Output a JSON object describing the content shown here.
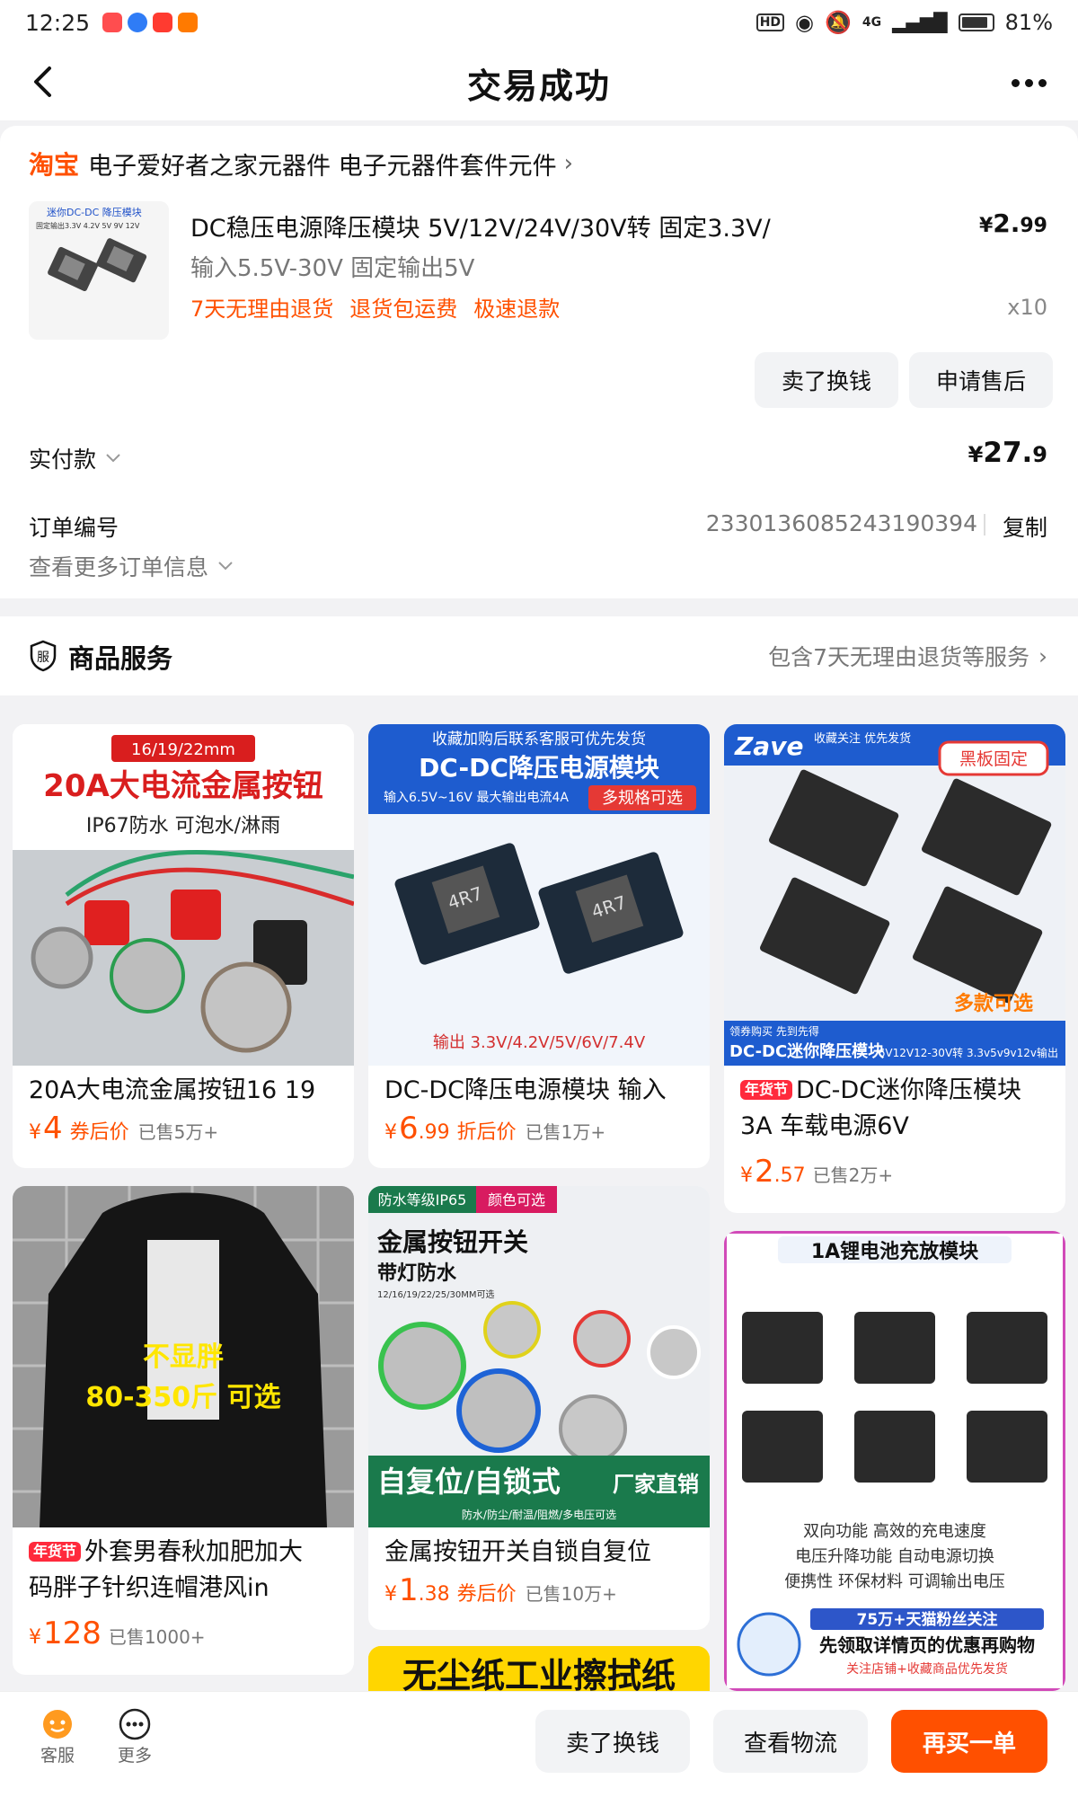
{
  "status_bar": {
    "time": "12:25",
    "hd": "HD",
    "network": "4G",
    "battery": "81%"
  },
  "nav": {
    "title": "交易成功"
  },
  "order": {
    "shop_tag": "淘宝",
    "shop_name": "电子爱好者之家元器件 电子元器件套件元件",
    "product_title": "DC稳压电源降压模块 5V/12V/24V/30V转 固定3.3V/",
    "product_spec": "输入5.5V-30V 固定输出5V",
    "product_tags": [
      "7天无理由退货",
      "退货包运费",
      "极速退款"
    ],
    "price_currency": "¥",
    "price_int": "2.",
    "price_dec": "99",
    "quantity": "x10",
    "thumb_text": "迷你DC-DC 降压模块",
    "thumb_sub": "固定输出3.3V 4.2V 5V 9V 12V",
    "btn_sell": "卖了换钱",
    "btn_aftersale": "申请售后",
    "paid_label": "实付款",
    "paid_currency": "¥",
    "paid_int": "27.",
    "paid_dec": "9",
    "order_no_label": "订单编号",
    "order_no": "2330136085243190394",
    "copy_label": "复制",
    "more_info": "查看更多订单信息"
  },
  "service": {
    "icon_glyph": "服",
    "title": "商品服务",
    "desc": "包含7天无理由退货等服务"
  },
  "feed": [
    {
      "img_top_tag": "16/19/22mm",
      "img_headline": "20A大电流金属按钮",
      "img_sub": "IP67防水 可泡水/淋雨",
      "title": "20A大电流金属按钮16 19",
      "price_int": "4",
      "price_dec": "",
      "price_tag": "券后价",
      "sold": "已售5万+"
    },
    {
      "img_top_tag": "收藏加购后联系客服可优先发货",
      "img_headline": "DC-DC降压电源模块",
      "img_sub": "输入6.5V~16V 最大输出电流4A",
      "img_sub2": "多规格可选",
      "img_bottom": "输出 3.3V/4.2V/5V/6V/7.4V",
      "img_chip": "4R7",
      "title": "DC-DC降压电源模块 输入",
      "price_int": "6",
      "price_dec": ".99",
      "price_tag": "折后价",
      "sold": "已售1万+"
    },
    {
      "img_brand": "Zave",
      "img_brand_sub": "收藏关注 优先发货",
      "img_badge": "黑板固定",
      "img_optional": "多款可选",
      "img_promo": "领券购买 先到先得",
      "img_bottom_left": "DC-DC迷你降压模块",
      "img_bottom_right": "6V12V12-30V转 3.3v5v9v12v输出",
      "badge": "年货节",
      "title_line1": "DC-DC迷你降压模块",
      "title_line2": "3A 车载电源6V",
      "price_int": "2",
      "price_dec": ".57",
      "price_tag": "",
      "sold": "已售2万+"
    },
    {
      "img_text1": "不显胖",
      "img_text2": "80-350斤 可选",
      "badge": "年货节",
      "title_line1": "外套男春秋加肥加大",
      "title_line2": "码胖子针织连帽港风in",
      "price_int": "128",
      "price_dec": "",
      "price_tag": "",
      "sold": "已售1000+"
    },
    {
      "img_tag1": "防水等级IP65",
      "img_tag2": "颜色可选",
      "img_headline": "金属按钮开关",
      "img_sub": "带灯防水",
      "img_spec": "12/16/19/22/25/30MM可选",
      "img_bottom": "自复位/自锁式",
      "img_bottom_tag": "厂家直销",
      "img_bottom_sub": "防水/防尘/耐温/阻燃/多电压可选",
      "title": "金属按钮开关自锁自复位",
      "price_int": "1",
      "price_dec": ".38",
      "price_tag": "券后价",
      "sold": "已售10万+"
    },
    {
      "img_headline": "1A锂电池充放模块",
      "img_text1": "双向功能  高效的充电速度",
      "img_text2": "电压升降功能  自动电源切换",
      "img_text3": "便携性  环保材料  可调输出电压",
      "img_fans": "75万+天猫粉丝关注",
      "img_detail": "先领取详情页的优惠再购物",
      "img_detail_sub": "关注店铺+收藏商品优先发货"
    },
    {
      "img_headline": "无尘纸工业擦拭纸"
    }
  ],
  "bottom_bar": {
    "service_label": "客服",
    "more_label": "更多",
    "btn_sell": "卖了换钱",
    "btn_logistics": "查看物流",
    "btn_rebuy": "再买一单"
  },
  "colors": {
    "accent": "#ff5000",
    "badge_red": "#ff2a3c",
    "text_grey": "#777777"
  }
}
